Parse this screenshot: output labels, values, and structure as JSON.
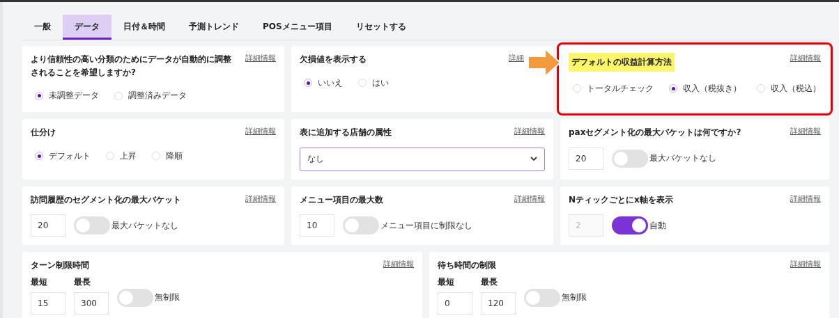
{
  "tabs": [
    {
      "label": "一般",
      "selected": false
    },
    {
      "label": "データ",
      "selected": true
    },
    {
      "label": "日付＆時間",
      "selected": false
    },
    {
      "label": "予測トレンド",
      "selected": false
    },
    {
      "label": "POSメニュー項目",
      "selected": false
    },
    {
      "label": "リセットする",
      "selected": false
    }
  ],
  "cards": [
    {
      "kind": "radio",
      "title": "より信頼性の高い分類のためにデータが自動的に調整されることを希望しますか?",
      "link": "詳細情報",
      "highlighted": false,
      "options": [
        {
          "label": "未調整データ",
          "selected": true
        },
        {
          "label": "調整済みデータ",
          "selected": false
        }
      ]
    },
    {
      "kind": "radio",
      "title": "欠損値を表示する",
      "link": "詳細",
      "highlighted": false,
      "options": [
        {
          "label": "いいえ",
          "selected": true
        },
        {
          "label": "はい",
          "selected": false
        }
      ]
    },
    {
      "kind": "radio",
      "title": "デフォルトの収益計算方法",
      "link": "詳細情報",
      "highlighted": true,
      "options": [
        {
          "label": "トータルチェック",
          "selected": false
        },
        {
          "label": "収入（税抜き）",
          "selected": true
        },
        {
          "label": "収入（税込）",
          "selected": false
        }
      ]
    },
    {
      "kind": "radio",
      "title": "仕分け",
      "link": "詳細情報",
      "highlighted": false,
      "options": [
        {
          "label": "デフォルト",
          "selected": true
        },
        {
          "label": "上昇",
          "selected": false
        },
        {
          "label": "降順",
          "selected": false
        }
      ]
    },
    {
      "kind": "select",
      "title": "表に追加する店舗の属性",
      "link": "詳細情報",
      "highlighted": false,
      "value": "なし"
    },
    {
      "kind": "number_toggle",
      "title": "paxセグメント化の最大バケットは何ですか?",
      "link": "詳細情報",
      "highlighted": false,
      "field": {
        "value": "20",
        "disabled": false
      },
      "toggle": {
        "label": "最大バケットなし",
        "on": false
      }
    },
    {
      "kind": "number_toggle",
      "title": "訪問履歴のセグメント化の最大バケット",
      "link": "詳細情報",
      "highlighted": false,
      "field": {
        "value": "20",
        "disabled": false
      },
      "toggle": {
        "label": "最大バケットなし",
        "on": false
      }
    },
    {
      "kind": "number_toggle",
      "title": "メニュー項目の最大数",
      "link": "詳細情報",
      "highlighted": false,
      "field": {
        "value": "10",
        "disabled": false
      },
      "toggle": {
        "label": "メニュー項目に制限なし",
        "on": false
      }
    },
    {
      "kind": "number_toggle",
      "title": "Nティックごとにx軸を表示",
      "link": "詳細情報",
      "highlighted": false,
      "field": {
        "value": "2",
        "disabled": true
      },
      "toggle": {
        "label": "自動",
        "on": true
      }
    }
  ],
  "wide_cards": [
    {
      "kind": "range_toggle",
      "title": "ターン制限時間",
      "link": "詳細情報",
      "highlighted": false,
      "min": {
        "label": "最短",
        "value": "15"
      },
      "max": {
        "label": "最長",
        "value": "300"
      },
      "toggle": {
        "label": "無制限",
        "on": false
      }
    },
    {
      "kind": "range_toggle",
      "title": "待ち時間の制限",
      "link": "詳細情報",
      "highlighted": false,
      "min": {
        "label": "最短",
        "value": "0"
      },
      "max": {
        "label": "最長",
        "value": "120"
      },
      "toggle": {
        "label": "無制限",
        "on": false
      }
    }
  ]
}
